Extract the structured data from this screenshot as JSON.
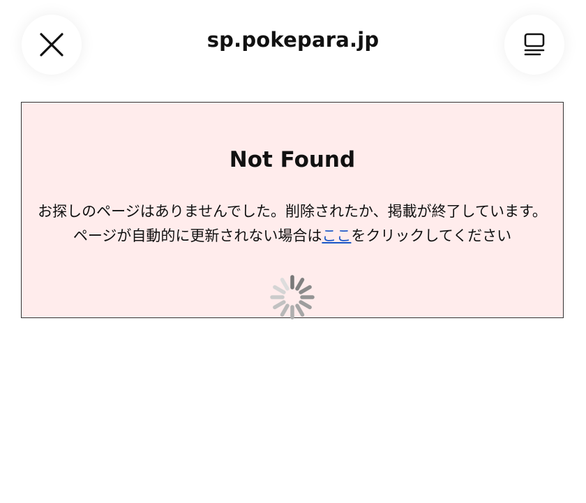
{
  "browser": {
    "url": "sp.pokepara.jp",
    "close_icon": "close-icon",
    "menu_icon": "tabs-menu-icon"
  },
  "notice": {
    "heading": "Not Found",
    "line1": "お探しのページはありませんでした。削除されたか、掲載が終了しています。",
    "line2_before": "ページが自動的に更新されない場合は",
    "link_text": "ここ",
    "line2_after": "をクリックしてください",
    "spinner_icon": "loading-spinner-icon"
  },
  "colors": {
    "notice_bg": "#ffecec",
    "link": "#1a56c7"
  }
}
